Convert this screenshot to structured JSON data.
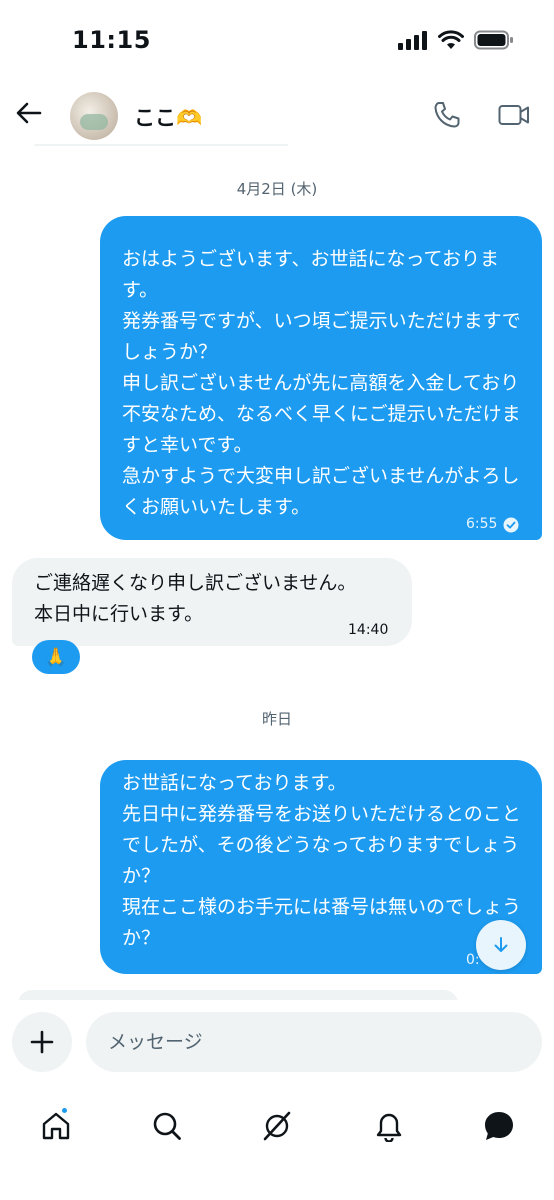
{
  "status_bar": {
    "time": "11:15"
  },
  "header": {
    "contact_name": "ここ🫶"
  },
  "messages": [
    {
      "type": "date",
      "label": "4月2日 (木)"
    },
    {
      "type": "outgoing",
      "text": "おはようございます、お世話になっております。\n発券番号ですが、いつ頃ご提示いただけますでしょうか？\n申し訳ございませんが先に高額を入金しており不安なため、なるべく早くにご提示いただけますと幸いです。\n急かすようで大変申し訳ございませんがよろしくお願いいたします。",
      "time": "6:55"
    },
    {
      "type": "incoming",
      "text": "ご連絡遅くなり申し訳ございません。\n本日中に行います。",
      "time": "14:40",
      "reaction": "🙏"
    },
    {
      "type": "date",
      "label": "昨日"
    },
    {
      "type": "outgoing",
      "text": "お世話になっております。\n先日中に発券番号をお送りいただけるとのことでしたが、その後どうなっておりますでしょうか？\n現在ここ様のお手元には番号は無いのでしょうか？",
      "time": "0:"
    }
  ],
  "composer": {
    "placeholder": "メッセージ"
  },
  "colors": {
    "accent": "#1d9bf0",
    "incoming_bg": "#eff3f4",
    "text": "#0f1419",
    "muted": "#536471"
  },
  "icons": {
    "status": [
      "signal-icon",
      "wifi-icon",
      "battery-icon"
    ],
    "header": [
      "back-arrow-icon",
      "phone-icon",
      "video-call-icon"
    ],
    "tabs": [
      "home-icon",
      "search-icon",
      "grok-icon",
      "bell-icon",
      "messages-icon"
    ]
  }
}
